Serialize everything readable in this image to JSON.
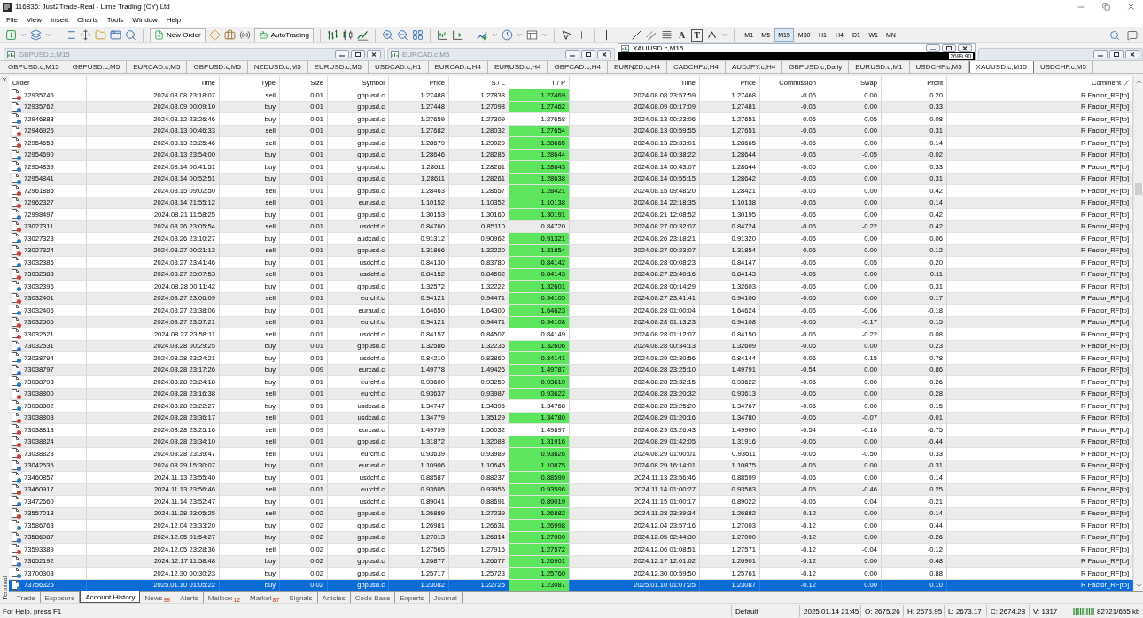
{
  "window": {
    "title": "116836: Just2Trade-Real - Lime Trading (CY) Ltd"
  },
  "menu": [
    "File",
    "View",
    "Insert",
    "Charts",
    "Tools",
    "Window",
    "Help"
  ],
  "toolbar": {
    "new_order": "New Order",
    "autotrading": "AutoTrading",
    "text_tools": [
      "A",
      "T"
    ],
    "periods": [
      {
        "label": "M1",
        "selected": false
      },
      {
        "label": "M5",
        "selected": false
      },
      {
        "label": "M15",
        "selected": true
      },
      {
        "label": "M30",
        "selected": false
      },
      {
        "label": "H1",
        "selected": false
      },
      {
        "label": "H4",
        "selected": false
      },
      {
        "label": "D1",
        "selected": false
      },
      {
        "label": "W1",
        "selected": false
      },
      {
        "label": "MN",
        "selected": false
      }
    ]
  },
  "chart_windows": [
    {
      "title": "GBPUSD.c,M15",
      "active": false
    },
    {
      "title": "EURCAD.c,M5",
      "active": false
    },
    {
      "title": "XAUUSD.c,M15",
      "active": true,
      "price_label": "2689.90"
    },
    {
      "active": false
    }
  ],
  "chart_tabs": [
    {
      "label": "GBPUSD.c,M15",
      "selected": false
    },
    {
      "label": "GBPUSD.c,M5",
      "selected": false
    },
    {
      "label": "EURCAD.c,M5",
      "selected": false
    },
    {
      "label": "GBPUSD.c,M5",
      "selected": false
    },
    {
      "label": "NZDUSD.c,M5",
      "selected": false
    },
    {
      "label": "EURUSD.c,M5",
      "selected": false
    },
    {
      "label": "USDCAD.c,H1",
      "selected": false
    },
    {
      "label": "EURCAD.c,H4",
      "selected": false
    },
    {
      "label": "EURUSD.c,H4",
      "selected": false
    },
    {
      "label": "GBPCAD.c,H4",
      "selected": false
    },
    {
      "label": "EURNZD.c,H4",
      "selected": false
    },
    {
      "label": "CADCHF.c,H4",
      "selected": false
    },
    {
      "label": "AUDJPY.c,H4",
      "selected": false
    },
    {
      "label": "GBPUSD.c,Daily",
      "selected": false
    },
    {
      "label": "EURUSD.c,M1",
      "selected": false
    },
    {
      "label": "USDCHF.c,M5",
      "selected": false
    },
    {
      "label": "XAUUSD.c,M15",
      "selected": true
    },
    {
      "label": "USDCHF.c,M5",
      "selected": false
    }
  ],
  "terminal": {
    "title": "Terminal",
    "columns": [
      {
        "label": "Order",
        "sorted": false
      },
      {
        "label": "Time",
        "sorted": false
      },
      {
        "label": "Type",
        "sorted": false
      },
      {
        "label": "Size",
        "sorted": false
      },
      {
        "label": "Symbol",
        "sorted": false
      },
      {
        "label": "Price",
        "sorted": false
      },
      {
        "label": "S / L",
        "sorted": false
      },
      {
        "label": "T / P",
        "sorted": false
      },
      {
        "label": "Time",
        "sorted": false
      },
      {
        "label": "Price",
        "sorted": false
      },
      {
        "label": "Commission",
        "sorted": false
      },
      {
        "label": "Swap",
        "sorted": false
      },
      {
        "label": "Profit",
        "sorted": false
      },
      {
        "label": "Comment",
        "sorted": true
      }
    ],
    "rows": [
      {
        "order": "72935746",
        "time": "2024.08.08 23:18:07",
        "type": "sell",
        "size": "0.01",
        "symbol": "gbpusd.c",
        "price": "1.27488",
        "sl": "1.27838",
        "tp": "1.27469",
        "tp_hit": true,
        "close_time": "2024.08.08 23:57:59",
        "close_price": "1.27468",
        "commission": "-0.06",
        "swap": "0.00",
        "profit": "0.20",
        "comment": "R Factor_RF[tp]",
        "color": "#d23b2f",
        "selected": false
      },
      {
        "order": "72935762",
        "time": "2024.08.09 00:09:10",
        "type": "buy",
        "size": "0.01",
        "symbol": "gbpusd.c",
        "price": "1.27448",
        "sl": "1.27098",
        "tp": "1.27462",
        "tp_hit": true,
        "close_time": "2024.08.09 00:17:09",
        "close_price": "1.27481",
        "commission": "-0.06",
        "swap": "0.00",
        "profit": "0.33",
        "comment": "R Factor_RF[tp]",
        "color": "#2b78c9",
        "selected": false
      },
      {
        "order": "72946883",
        "time": "2024.08.12 23:26:46",
        "type": "buy",
        "size": "0.01",
        "symbol": "gbpusd.c",
        "price": "1.27659",
        "sl": "1.27309",
        "tp": "1.27658",
        "tp_hit": false,
        "close_time": "2024.08.13 00:23:06",
        "close_price": "1.27651",
        "commission": "-0.06",
        "swap": "-0.05",
        "profit": "-0.08",
        "comment": "R Factor_RF[tp]",
        "color": "#2b78c9",
        "selected": false
      },
      {
        "order": "72946925",
        "time": "2024.08.13 00:46:33",
        "type": "sell",
        "size": "0.01",
        "symbol": "gbpusd.c",
        "price": "1.27682",
        "sl": "1.28032",
        "tp": "1.27654",
        "tp_hit": true,
        "close_time": "2024.08.13 00:59:55",
        "close_price": "1.27651",
        "commission": "-0.06",
        "swap": "0.00",
        "profit": "0.31",
        "comment": "R Factor_RF[tp]",
        "color": "#d23b2f",
        "selected": false
      },
      {
        "order": "72954653",
        "time": "2024.08.13 23:25:46",
        "type": "sell",
        "size": "0.01",
        "symbol": "gbpusd.c",
        "price": "1.28679",
        "sl": "1.29029",
        "tp": "1.28665",
        "tp_hit": true,
        "close_time": "2024.08.13 23:33:01",
        "close_price": "1.28665",
        "commission": "-0.06",
        "swap": "0.00",
        "profit": "0.14",
        "comment": "R Factor_RF[tp]",
        "color": "#d23b2f",
        "selected": false
      },
      {
        "order": "72954690",
        "time": "2024.08.13 23:54:00",
        "type": "buy",
        "size": "0.01",
        "symbol": "gbpusd.c",
        "price": "1.28646",
        "sl": "1.28285",
        "tp": "1.28644",
        "tp_hit": true,
        "close_time": "2024.08.14 00:38:22",
        "close_price": "1.28644",
        "commission": "-0.06",
        "swap": "-0.05",
        "profit": "-0.02",
        "comment": "R Factor_RF[tp]",
        "color": "#2b78c9",
        "selected": false
      },
      {
        "order": "72954839",
        "time": "2024.08.14 00:41:51",
        "type": "buy",
        "size": "0.01",
        "symbol": "gbpusd.c",
        "price": "1.28611",
        "sl": "1.28261",
        "tp": "1.28643",
        "tp_hit": true,
        "close_time": "2024.08.14 00:43:07",
        "close_price": "1.28644",
        "commission": "-0.06",
        "swap": "0.00",
        "profit": "0.33",
        "comment": "R Factor_RF[tp]",
        "color": "#2b78c9",
        "selected": false
      },
      {
        "order": "72954841",
        "time": "2024.08.14 00:52:51",
        "type": "buy",
        "size": "0.01",
        "symbol": "gbpusd.c",
        "price": "1.28611",
        "sl": "1.28261",
        "tp": "1.28638",
        "tp_hit": true,
        "close_time": "2024.08.14 00:55:15",
        "close_price": "1.28642",
        "commission": "-0.06",
        "swap": "0.00",
        "profit": "0.31",
        "comment": "R Factor_RF[tp]",
        "color": "#2b78c9",
        "selected": false
      },
      {
        "order": "72961886",
        "time": "2024.08.15 09:02:50",
        "type": "sell",
        "size": "0.01",
        "symbol": "gbpusd.c",
        "price": "1.28463",
        "sl": "1.28657",
        "tp": "1.28421",
        "tp_hit": true,
        "close_time": "2024.08.15 09:48:20",
        "close_price": "1.28421",
        "commission": "-0.06",
        "swap": "0.00",
        "profit": "0.42",
        "comment": "R Factor_RF[tp]",
        "color": "#d23b2f",
        "selected": false
      },
      {
        "order": "72962327",
        "time": "2024.08.14 21:55:12",
        "type": "sell",
        "size": "0.01",
        "symbol": "eurusd.c",
        "price": "1.10152",
        "sl": "1.10352",
        "tp": "1.10138",
        "tp_hit": true,
        "close_time": "2024.08.14 22:18:35",
        "close_price": "1.10138",
        "commission": "-0.06",
        "swap": "0.00",
        "profit": "0.14",
        "comment": "R Factor_RF[tp]",
        "color": "#d23b2f",
        "selected": false
      },
      {
        "order": "72998497",
        "time": "2024.08.21 11:58:25",
        "type": "buy",
        "size": "0.01",
        "symbol": "gbpusd.c",
        "price": "1.30153",
        "sl": "1.30160",
        "tp": "1.30191",
        "tp_hit": true,
        "close_time": "2024.08.21 12:08:52",
        "close_price": "1.30195",
        "commission": "-0.06",
        "swap": "0.00",
        "profit": "0.42",
        "comment": "R Factor_RF[tp]",
        "color": "#2b78c9",
        "selected": false
      },
      {
        "order": "73027311",
        "time": "2024.08.26 23:05:54",
        "type": "sell",
        "size": "0.01",
        "symbol": "usdchf.c",
        "price": "0.84760",
        "sl": "0.85110",
        "tp": "0.84720",
        "tp_hit": false,
        "close_time": "2024.08.27 00:32:07",
        "close_price": "0.84724",
        "commission": "-0.06",
        "swap": "-0.22",
        "profit": "0.42",
        "comment": "R Factor_RF[tp]",
        "color": "#d23b2f",
        "selected": false
      },
      {
        "order": "73027323",
        "time": "2024.08.26 23:10:27",
        "type": "buy",
        "size": "0.01",
        "symbol": "audcad.c",
        "price": "0.91312",
        "sl": "0.90962",
        "tp": "0.91321",
        "tp_hit": true,
        "close_time": "2024.08.26 23:18:21",
        "close_price": "0.91320",
        "commission": "-0.06",
        "swap": "0.00",
        "profit": "0.06",
        "comment": "R Factor_RF[tp]",
        "color": "#2b78c9",
        "selected": false
      },
      {
        "order": "73027324",
        "time": "2024.08.27 00:21:13",
        "type": "sell",
        "size": "0.01",
        "symbol": "gbpusd.c",
        "price": "1.31866",
        "sl": "1.32220",
        "tp": "1.31854",
        "tp_hit": true,
        "close_time": "2024.08.27 00:23:07",
        "close_price": "1.31854",
        "commission": "-0.06",
        "swap": "0.00",
        "profit": "0.12",
        "comment": "R Factor_RF[tp]",
        "color": "#d23b2f",
        "selected": false
      },
      {
        "order": "73032386",
        "time": "2024.08.27 23:41:46",
        "type": "buy",
        "size": "0.01",
        "symbol": "usdchf.c",
        "price": "0.84130",
        "sl": "0.83780",
        "tp": "0.84142",
        "tp_hit": true,
        "close_time": "2024.08.28 00:08:23",
        "close_price": "0.84147",
        "commission": "-0.06",
        "swap": "0.05",
        "profit": "0.20",
        "comment": "R Factor_RF[tp]",
        "color": "#2b78c9",
        "selected": false
      },
      {
        "order": "73032388",
        "time": "2024.08.27 23:07:53",
        "type": "sell",
        "size": "0.01",
        "symbol": "usdchf.c",
        "price": "0.84152",
        "sl": "0.84502",
        "tp": "0.84143",
        "tp_hit": true,
        "close_time": "2024.08.27 23:40:16",
        "close_price": "0.84143",
        "commission": "-0.06",
        "swap": "0.00",
        "profit": "0.11",
        "comment": "R Factor_RF[tp]",
        "color": "#d23b2f",
        "selected": false
      },
      {
        "order": "73032396",
        "time": "2024.08.28 00:11:42",
        "type": "buy",
        "size": "0.01",
        "symbol": "gbpusd.c",
        "price": "1.32572",
        "sl": "1.32222",
        "tp": "1.32601",
        "tp_hit": true,
        "close_time": "2024.08.28 00:14:29",
        "close_price": "1.32603",
        "commission": "-0.06",
        "swap": "0.00",
        "profit": "0.31",
        "comment": "R Factor_RF[tp]",
        "color": "#2b78c9",
        "selected": false
      },
      {
        "order": "73032401",
        "time": "2024.08.27 23:06:09",
        "type": "sell",
        "size": "0.01",
        "symbol": "eurchf.c",
        "price": "0.94121",
        "sl": "0.94471",
        "tp": "0.94105",
        "tp_hit": true,
        "close_time": "2024.08.27 23:41:41",
        "close_price": "0.94106",
        "commission": "-0.06",
        "swap": "0.00",
        "profit": "0.17",
        "comment": "R Factor_RF[tp]",
        "color": "#d23b2f",
        "selected": false
      },
      {
        "order": "73032406",
        "time": "2024.08.27 23:38:06",
        "type": "buy",
        "size": "0.01",
        "symbol": "euraud.c",
        "price": "1.64650",
        "sl": "1.64300",
        "tp": "1.64623",
        "tp_hit": true,
        "close_time": "2024.08.28 01:00:04",
        "close_price": "1.64624",
        "commission": "-0.06",
        "swap": "-0.06",
        "profit": "-0.18",
        "comment": "R Factor_RF[tp]",
        "color": "#2b78c9",
        "selected": false
      },
      {
        "order": "73032506",
        "time": "2024.08.27 23:57:21",
        "type": "sell",
        "size": "0.01",
        "symbol": "eurchf.c",
        "price": "0.94121",
        "sl": "0.94471",
        "tp": "0.94108",
        "tp_hit": true,
        "close_time": "2024.08.28 01:13:23",
        "close_price": "0.94108",
        "commission": "-0.06",
        "swap": "-0.17",
        "profit": "0.15",
        "comment": "R Factor_RF[tp]",
        "color": "#d23b2f",
        "selected": false
      },
      {
        "order": "73032521",
        "time": "2024.08.27 23:58:11",
        "type": "sell",
        "size": "0.01",
        "symbol": "usdchf.c",
        "price": "0.84157",
        "sl": "0.84507",
        "tp": "0.84149",
        "tp_hit": false,
        "close_time": "2024.08.28 01:12:07",
        "close_price": "0.84150",
        "commission": "-0.06",
        "swap": "-0.22",
        "profit": "0.08",
        "comment": "R Factor_RF[tp]",
        "color": "#d23b2f",
        "selected": false
      },
      {
        "order": "73032531",
        "time": "2024.08.28 00:29:25",
        "type": "buy",
        "size": "0.01",
        "symbol": "gbpusd.c",
        "price": "1.32586",
        "sl": "1.32236",
        "tp": "1.32606",
        "tp_hit": true,
        "close_time": "2024.08.28 00:34:13",
        "close_price": "1.32609",
        "commission": "-0.06",
        "swap": "0.00",
        "profit": "0.23",
        "comment": "R Factor_RF[tp]",
        "color": "#2b78c9",
        "selected": false
      },
      {
        "order": "73038794",
        "time": "2024.08.28 23:24:21",
        "type": "buy",
        "size": "0.01",
        "symbol": "usdchf.c",
        "price": "0.84210",
        "sl": "0.83860",
        "tp": "0.84141",
        "tp_hit": true,
        "close_time": "2024.08.29 02:30:56",
        "close_price": "0.84144",
        "commission": "-0.06",
        "swap": "0.15",
        "profit": "-0.78",
        "comment": "R Factor_RF[tp]",
        "color": "#2b78c9",
        "selected": false
      },
      {
        "order": "73038797",
        "time": "2024.08.28 23:17:26",
        "type": "buy",
        "size": "0.09",
        "symbol": "eurcad.c",
        "price": "1.49778",
        "sl": "1.49426",
        "tp": "1.49787",
        "tp_hit": true,
        "close_time": "2024.08.28 23:25:10",
        "close_price": "1.49791",
        "commission": "-0.54",
        "swap": "0.00",
        "profit": "0.86",
        "comment": "R Factor_RF[tp]",
        "color": "#2b78c9",
        "selected": false
      },
      {
        "order": "73038798",
        "time": "2024.08.28 23:24:18",
        "type": "buy",
        "size": "0.01",
        "symbol": "eurchf.c",
        "price": "0.93600",
        "sl": "0.93250",
        "tp": "0.93619",
        "tp_hit": true,
        "close_time": "2024.08.28 23:32:15",
        "close_price": "0.93622",
        "commission": "-0.06",
        "swap": "0.00",
        "profit": "0.26",
        "comment": "R Factor_RF[tp]",
        "color": "#2b78c9",
        "selected": false
      },
      {
        "order": "73038800",
        "time": "2024.08.28 23:16:38",
        "type": "sell",
        "size": "0.01",
        "symbol": "eurchf.c",
        "price": "0.93637",
        "sl": "0.93987",
        "tp": "0.93622",
        "tp_hit": true,
        "close_time": "2024.08.28 23:20:32",
        "close_price": "0.93613",
        "commission": "-0.06",
        "swap": "0.00",
        "profit": "0.28",
        "comment": "R Factor_RF[tp]",
        "color": "#d23b2f",
        "selected": false
      },
      {
        "order": "73038802",
        "time": "2024.08.28 23:22:27",
        "type": "buy",
        "size": "0.01",
        "symbol": "usdcad.c",
        "price": "1.34747",
        "sl": "1.34395",
        "tp": "1.34768",
        "tp_hit": false,
        "close_time": "2024.08.28 23:25:20",
        "close_price": "1.34767",
        "commission": "-0.06",
        "swap": "0.00",
        "profit": "0.15",
        "comment": "R Factor_RF[tp]",
        "color": "#2b78c9",
        "selected": false
      },
      {
        "order": "73038803",
        "time": "2024.08.28 23:36:17",
        "type": "sell",
        "size": "0.01",
        "symbol": "usdcad.c",
        "price": "1.34779",
        "sl": "1.35129",
        "tp": "1.34780",
        "tp_hit": true,
        "close_time": "2024.08.29 01:20:16",
        "close_price": "1.34780",
        "commission": "-0.06",
        "swap": "-0.07",
        "profit": "-0.01",
        "comment": "R Factor_RF[tp]",
        "color": "#d23b2f",
        "selected": false
      },
      {
        "order": "73038813",
        "time": "2024.08.28 23:25:16",
        "type": "sell",
        "size": "0.09",
        "symbol": "eurcad.c",
        "price": "1.49799",
        "sl": "1.50032",
        "tp": "1.49897",
        "tp_hit": false,
        "close_time": "2024.08.29 03:26:43",
        "close_price": "1.49900",
        "commission": "-0.54",
        "swap": "-0.16",
        "profit": "-6.75",
        "comment": "R Factor_RF[tp]",
        "color": "#d23b2f",
        "selected": false
      },
      {
        "order": "73038824",
        "time": "2024.08.28 23:34:10",
        "type": "sell",
        "size": "0.01",
        "symbol": "gbpusd.c",
        "price": "1.31872",
        "sl": "1.32088",
        "tp": "1.31916",
        "tp_hit": true,
        "close_time": "2024.08.29 01:42:05",
        "close_price": "1.31916",
        "commission": "-0.06",
        "swap": "0.00",
        "profit": "-0.44",
        "comment": "R Factor_RF[tp]",
        "color": "#d23b2f",
        "selected": false
      },
      {
        "order": "73038828",
        "time": "2024.08.28 23:39:47",
        "type": "sell",
        "size": "0.01",
        "symbol": "eurchf.c",
        "price": "0.93639",
        "sl": "0.93989",
        "tp": "0.93626",
        "tp_hit": true,
        "close_time": "2024.08.29 01:00:01",
        "close_price": "0.93611",
        "commission": "-0.06",
        "swap": "-0.50",
        "profit": "0.33",
        "comment": "R Factor_RF[tp]",
        "color": "#d23b2f",
        "selected": false
      },
      {
        "order": "73042535",
        "time": "2024.08.29 15:30:07",
        "type": "buy",
        "size": "0.01",
        "symbol": "eurusd.c",
        "price": "1.10906",
        "sl": "1.10645",
        "tp": "1.10875",
        "tp_hit": true,
        "close_time": "2024.08.29 16:14:01",
        "close_price": "1.10875",
        "commission": "-0.06",
        "swap": "0.00",
        "profit": "-0.31",
        "comment": "R Factor_RF[tp]",
        "color": "#2b78c9",
        "selected": false
      },
      {
        "order": "73460857",
        "time": "2024.11.13 23:55:40",
        "type": "buy",
        "size": "0.01",
        "symbol": "usdchf.c",
        "price": "0.88587",
        "sl": "0.88237",
        "tp": "0.88599",
        "tp_hit": true,
        "close_time": "2024.11.13 23:56:46",
        "close_price": "0.88599",
        "commission": "-0.06",
        "swap": "0.00",
        "profit": "0.14",
        "comment": "R Factor_RF[tp]",
        "color": "#2b78c9",
        "selected": false
      },
      {
        "order": "73460917",
        "time": "2024.11.13 23:56:46",
        "type": "sell",
        "size": "0.01",
        "symbol": "eurchf.c",
        "price": "0.93605",
        "sl": "0.93956",
        "tp": "0.93596",
        "tp_hit": true,
        "close_time": "2024.11.14 01:00:27",
        "close_price": "0.93583",
        "commission": "-0.06",
        "swap": "-0.46",
        "profit": "0.25",
        "comment": "R Factor_RF[tp]",
        "color": "#d23b2f",
        "selected": false
      },
      {
        "order": "73472660",
        "time": "2024.11.14 23:52:47",
        "type": "buy",
        "size": "0.01",
        "symbol": "usdchf.c",
        "price": "0.89041",
        "sl": "0.88691",
        "tp": "0.89019",
        "tp_hit": true,
        "close_time": "2024.11.15 01:00:17",
        "close_price": "0.89022",
        "commission": "-0.06",
        "swap": "0.04",
        "profit": "-0.21",
        "comment": "R Factor_RF[tp]",
        "color": "#2b78c9",
        "selected": false
      },
      {
        "order": "73557018",
        "time": "2024.11.28 23:05:25",
        "type": "sell",
        "size": "0.02",
        "symbol": "gbpusd.c",
        "price": "1.26889",
        "sl": "1.27239",
        "tp": "1.26882",
        "tp_hit": true,
        "close_time": "2024.11.28 23:39:34",
        "close_price": "1.26882",
        "commission": "-0.12",
        "swap": "0.00",
        "profit": "0.14",
        "comment": "R Factor_RF[tp]",
        "color": "#d23b2f",
        "selected": false
      },
      {
        "order": "73586763",
        "time": "2024.12.04 23:33:20",
        "type": "buy",
        "size": "0.02",
        "symbol": "gbpusd.c",
        "price": "1.26981",
        "sl": "1.26631",
        "tp": "1.26998",
        "tp_hit": true,
        "close_time": "2024.12.04 23:57:16",
        "close_price": "1.27003",
        "commission": "-0.12",
        "swap": "0.00",
        "profit": "0.44",
        "comment": "R Factor_RF[tp]",
        "color": "#2b78c9",
        "selected": false
      },
      {
        "order": "73586987",
        "time": "2024.12.05 01:54:27",
        "type": "buy",
        "size": "0.02",
        "symbol": "gbpusd.c",
        "price": "1.27013",
        "sl": "1.26814",
        "tp": "1.27000",
        "tp_hit": true,
        "close_time": "2024.12.05 02:44:30",
        "close_price": "1.27000",
        "commission": "-0.12",
        "swap": "0.00",
        "profit": "-0.26",
        "comment": "R Factor_RF[tp]",
        "color": "#2b78c9",
        "selected": false
      },
      {
        "order": "73593389",
        "time": "2024.12.05 23:28:36",
        "type": "sell",
        "size": "0.02",
        "symbol": "gbpusd.c",
        "price": "1.27565",
        "sl": "1.27915",
        "tp": "1.27572",
        "tp_hit": true,
        "close_time": "2024.12.06 01:08:51",
        "close_price": "1.27571",
        "commission": "-0.12",
        "swap": "-0.04",
        "profit": "-0.12",
        "comment": "R Factor_RF[tp]",
        "color": "#d23b2f",
        "selected": false
      },
      {
        "order": "73652192",
        "time": "2024.12.17 11:58:48",
        "type": "buy",
        "size": "0.02",
        "symbol": "gbpusd.c",
        "price": "1.26877",
        "sl": "1.26677",
        "tp": "1.26901",
        "tp_hit": true,
        "close_time": "2024.12.17 12:01:02",
        "close_price": "1.26901",
        "commission": "-0.12",
        "swap": "0.00",
        "profit": "0.48",
        "comment": "R Factor_RF[tp]",
        "color": "#2b78c9",
        "selected": false
      },
      {
        "order": "73700303",
        "time": "2024.12.30 00:30:23",
        "type": "buy",
        "size": "0.02",
        "symbol": "gbpusd.c",
        "price": "1.25717",
        "sl": "1.25723",
        "tp": "1.25760",
        "tp_hit": true,
        "close_time": "2024.12.30 00:59:50",
        "close_price": "1.25761",
        "commission": "-0.12",
        "swap": "0.00",
        "profit": "0.88",
        "comment": "R Factor_RF[tp]",
        "color": "#2b78c9",
        "selected": false
      },
      {
        "order": "73756325",
        "time": "2025.01.10 01:05:22",
        "type": "buy",
        "size": "0.02",
        "symbol": "gbpusd.c",
        "price": "1.23082",
        "sl": "1.22725",
        "tp": "1.23087",
        "tp_hit": true,
        "close_time": "2025.01.10 01:07:25",
        "close_price": "1.23087",
        "commission": "-0.12",
        "swap": "0.00",
        "profit": "0.10",
        "comment": "R Factor_RF[tp]",
        "color": "#2b78c9",
        "selected": true
      }
    ],
    "tabs": [
      {
        "label": "Trade",
        "selected": false
      },
      {
        "label": "Exposure",
        "selected": false
      },
      {
        "label": "Account History",
        "selected": true
      },
      {
        "label": "News",
        "count": "99",
        "selected": false
      },
      {
        "label": "Alerts",
        "selected": false
      },
      {
        "label": "Mailbox",
        "count": "12",
        "selected": false
      },
      {
        "label": "Market",
        "count": "87",
        "selected": false
      },
      {
        "label": "Signals",
        "selected": false
      },
      {
        "label": "Articles",
        "selected": false
      },
      {
        "label": "Code Base",
        "selected": false
      },
      {
        "label": "Experts",
        "selected": false
      },
      {
        "label": "Journal",
        "selected": false
      }
    ]
  },
  "status_bar": {
    "help": "For Help, press F1",
    "profile": "Default",
    "datetime": "2025.01.14 21:45",
    "open": "O: 2675.26",
    "high": "H: 2675.95",
    "low": "L: 2673.17",
    "close": "C: 2674.28",
    "volume": "V: 1317",
    "memory": "82721/655 kb"
  }
}
